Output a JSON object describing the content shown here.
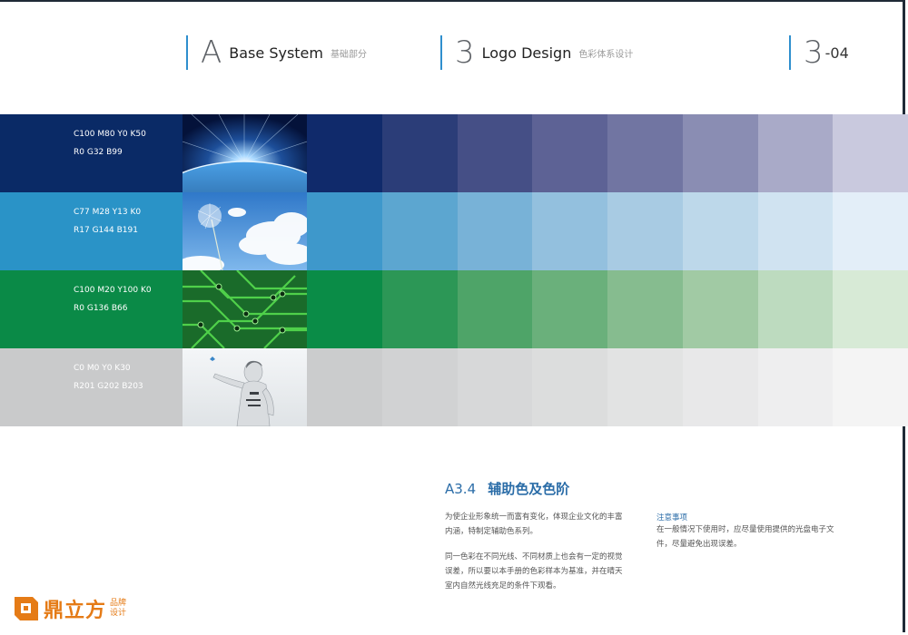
{
  "header": {
    "section_a": {
      "letter": "A",
      "title_en": "Base System",
      "title_cn": "基础部分"
    },
    "section_3": {
      "letter": "3",
      "title_en": "Logo Design",
      "title_cn": "色彩体系设计"
    },
    "page": {
      "number": "3",
      "suffix": "-04"
    }
  },
  "bands": [
    {
      "cmyk": "C100  M80  Y0  K50",
      "rgb": "R0  G32  B99",
      "photo": "earth-from-space-image",
      "swatches": [
        "#102a6b",
        "#2b3d78",
        "#454f86",
        "#5d6295",
        "#7175a2",
        "#8a8db3",
        "#a9aac8",
        "#c9c9de"
      ]
    },
    {
      "cmyk": "C77  M28  Y13  K0",
      "rgb": "R17  G144  B191",
      "photo": "sky-dandelion-image",
      "swatches": [
        "#3e98cb",
        "#5ca6d0",
        "#78b2d7",
        "#93c0de",
        "#a8cbe3",
        "#bdd8ea",
        "#d0e3f1",
        "#e3eef8"
      ]
    },
    {
      "cmyk": "C100  M20  Y100  K0",
      "rgb": "R0  G136  B66",
      "photo": "circuit-board-image",
      "swatches": [
        "#0a8c47",
        "#2c9756",
        "#4ea468",
        "#6ab07b",
        "#86bc8f",
        "#a1caa4",
        "#bddbbf",
        "#d7ead6"
      ]
    },
    {
      "cmyk": "C0  M0  Y0  K30",
      "rgb": "R201  G202  B203",
      "photo": "robot-figure-image",
      "swatches": [
        "#cbcccd",
        "#d1d2d3",
        "#d7d8d9",
        "#dcdddd",
        "#e2e3e3",
        "#e8e8e9",
        "#eeeeef",
        "#f4f4f4"
      ]
    }
  ],
  "section": {
    "code": "A3.4",
    "title": "辅助色及色阶",
    "para1_line1": "为使企业形象统一而富有变化，体现企业文化的丰富",
    "para1_line2": "内涵，特制定辅助色系列。",
    "para2_line1": "同一色彩在不同光线、不同材质上也会有一定的视觉",
    "para2_line2": "误差，所以要以本手册的色彩样本为基准，并在晴天",
    "para2_line3": "室内自然光线充足的条件下观看。",
    "note_title": "注意事项",
    "note_line1": "在一般情况下使用时，应尽量使用提供的光盘电子文",
    "note_line2": "件，尽量避免出现误差。"
  },
  "brand": {
    "name": "鼎立方",
    "tag_line1": "品牌",
    "tag_line2": "设计",
    "color": "#e57b16"
  }
}
